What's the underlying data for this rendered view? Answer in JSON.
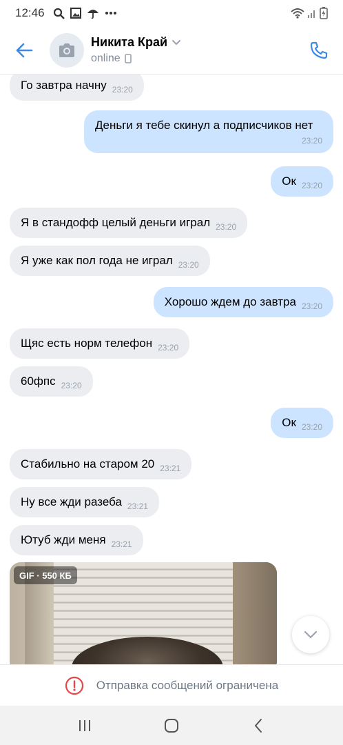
{
  "status_bar": {
    "time": "12:46",
    "icons": [
      "search-icon",
      "image-icon",
      "umbrella-icon",
      "more-icon"
    ],
    "right_icons": [
      "wifi-icon",
      "signal-icon",
      "battery-icon"
    ]
  },
  "header": {
    "back_icon": "arrow-left-icon",
    "name": "Никита Край",
    "status": "online",
    "status_device_icon": "phone-device-icon",
    "call_icon": "phone-icon",
    "accent_color": "#3f8ae0"
  },
  "messages": [
    {
      "dir": "in",
      "text": "Го завтра начну",
      "time": "23:20"
    },
    {
      "dir": "out",
      "text": "Деньги я тебе скинул а подписчиков нет",
      "time": "23:20"
    },
    {
      "dir": "out",
      "text": "Ок",
      "time": "23:20"
    },
    {
      "dir": "in",
      "text": "Я в стандофф целый деньги играл",
      "time": "23:20"
    },
    {
      "dir": "in",
      "text": "Я уже как пол года не играл",
      "time": "23:20"
    },
    {
      "dir": "out",
      "text": "Хорошо ждем до завтра",
      "time": "23:20"
    },
    {
      "dir": "in",
      "text": "Щяс есть норм телефон",
      "time": "23:20"
    },
    {
      "dir": "in",
      "text": "60фпс",
      "time": "23:20"
    },
    {
      "dir": "out",
      "text": "Ок",
      "time": "23:20"
    },
    {
      "dir": "in",
      "text": "Стабильно на старом 20",
      "time": "23:21"
    },
    {
      "dir": "in",
      "text": "Ну все жди разеба",
      "time": "23:21"
    },
    {
      "dir": "in",
      "text": "Ютуб жди меня",
      "time": "23:21"
    }
  ],
  "gif": {
    "badge": "GIF · 550 КБ"
  },
  "restriction": {
    "icon": "error-circle-icon",
    "text": "Отправка сообщений ограничена"
  },
  "colors": {
    "incoming_bubble": "#ebedf0",
    "outgoing_bubble": "#cce4ff",
    "error": "#e64646"
  }
}
